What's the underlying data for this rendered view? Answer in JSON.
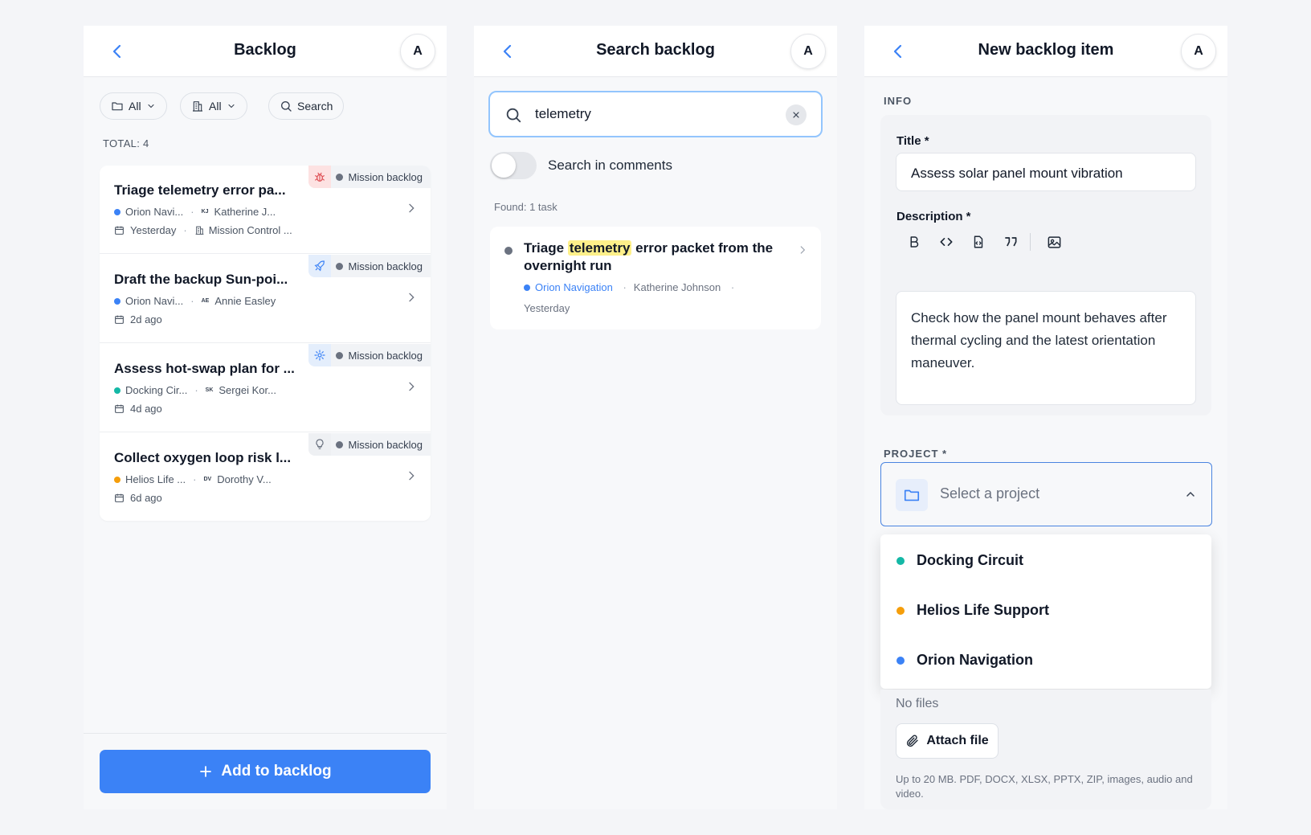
{
  "colors": {
    "accent": "#3b82f6",
    "orion": "#3b82f6",
    "docking": "#14b8a6",
    "helios": "#f59e0b",
    "neutral_dot": "#6b7280",
    "highlight": "#fef08a"
  },
  "backlog": {
    "title": "Backlog",
    "avatar": "A",
    "filters": {
      "folder": "All",
      "building": "All",
      "search": "Search"
    },
    "total": "TOTAL: 4",
    "items": [
      {
        "title": "Triage telemetry error pa...",
        "project": "Orion Navi...",
        "project_color": "#3b82f6",
        "assignee_initials": "KJ",
        "assignee": "Katherine J...",
        "date": "Yesterday",
        "location": "Mission Control ...",
        "tag": "Mission backlog",
        "tag_icon": "bug-icon"
      },
      {
        "title": "Draft the backup Sun-poi...",
        "project": "Orion Navi...",
        "project_color": "#3b82f6",
        "assignee_initials": "AE",
        "assignee": "Annie Easley",
        "date": "2d ago",
        "tag": "Mission backlog",
        "tag_icon": "rocket-icon"
      },
      {
        "title": "Assess hot-swap plan for ...",
        "project": "Docking Cir...",
        "project_color": "#14b8a6",
        "assignee_initials": "SK",
        "assignee": "Sergei Kor...",
        "date": "4d ago",
        "tag": "Mission backlog",
        "tag_icon": "gear-icon"
      },
      {
        "title": "Collect oxygen loop risk l...",
        "project": "Helios Life ...",
        "project_color": "#f59e0b",
        "assignee_initials": "DV",
        "assignee": "Dorothy V...",
        "date": "6d ago",
        "tag": "Mission backlog",
        "tag_icon": "lightbulb-icon"
      }
    ],
    "add_button": "Add to backlog"
  },
  "search": {
    "title": "Search backlog",
    "avatar": "A",
    "query": "telemetry",
    "toggle_label": "Search in comments",
    "toggle_on": false,
    "found": "Found: 1 task",
    "result": {
      "title_before": "Triage ",
      "title_match": "telemetry",
      "title_after": " error packet from the overnight run",
      "project": "Orion Navigation",
      "assignee": "Katherine Johnson",
      "date": "Yesterday"
    }
  },
  "new_item": {
    "title": "New backlog item",
    "avatar": "A",
    "info_section": "INFO",
    "title_label": "Title *",
    "title_value": "Assess solar panel mount vibration",
    "description_label": "Description *",
    "description_value": "Check how the panel mount behaves after thermal cycling and the latest orientation maneuver.",
    "toolbar_icons": [
      "bold-icon",
      "code-icon",
      "file-code-icon",
      "quote-icon",
      "image-icon"
    ],
    "project_label": "PROJECT *",
    "project_placeholder": "Select a project",
    "project_options": [
      {
        "name": "Docking Circuit",
        "color": "#14b8a6"
      },
      {
        "name": "Helios Life Support",
        "color": "#f59e0b"
      },
      {
        "name": "Orion Navigation",
        "color": "#3b82f6"
      }
    ],
    "no_files": "No files",
    "attach_button": "Attach file",
    "attach_hint": "Up to 20 MB. PDF, DOCX, XLSX, PPTX, ZIP, images, audio and video."
  }
}
